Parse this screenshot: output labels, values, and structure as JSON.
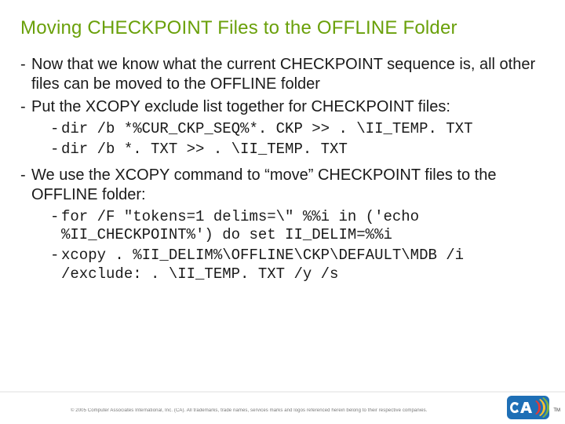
{
  "title": "Moving CHECKPOINT Files to the OFFLINE Folder",
  "bullets": {
    "b1": "Now that we know what the current CHECKPOINT sequence is, all other files can be moved to the OFFLINE folder",
    "b2": "Put the XCOPY exclude list together for CHECKPOINT files:",
    "b2_code1": "dir /b *%CUR_CKP_SEQ%*. CKP >> . \\II_TEMP. TXT",
    "b2_code2": "dir /b *. TXT >> . \\II_TEMP. TXT",
    "b3": "We use the XCOPY command to “move” CHECKPOINT files to the OFFLINE folder:",
    "b3_code1": "for /F \"tokens=1 delims=\\\" %%i in ('echo %II_CHECKPOINT%') do set II_DELIM=%%i",
    "b3_code2": "xcopy . %II_DELIM%\\OFFLINE\\CKP\\DEFAULT\\MDB /i /exclude: . \\II_TEMP. TXT /y /s"
  },
  "footer": {
    "copyright": "© 2005 Computer Associates International, Inc. (CA). All trademarks, trade names, services marks and logos referenced herein belong to their respective companies.",
    "tm": "TM"
  },
  "logo": {
    "name": "ca-logo"
  }
}
